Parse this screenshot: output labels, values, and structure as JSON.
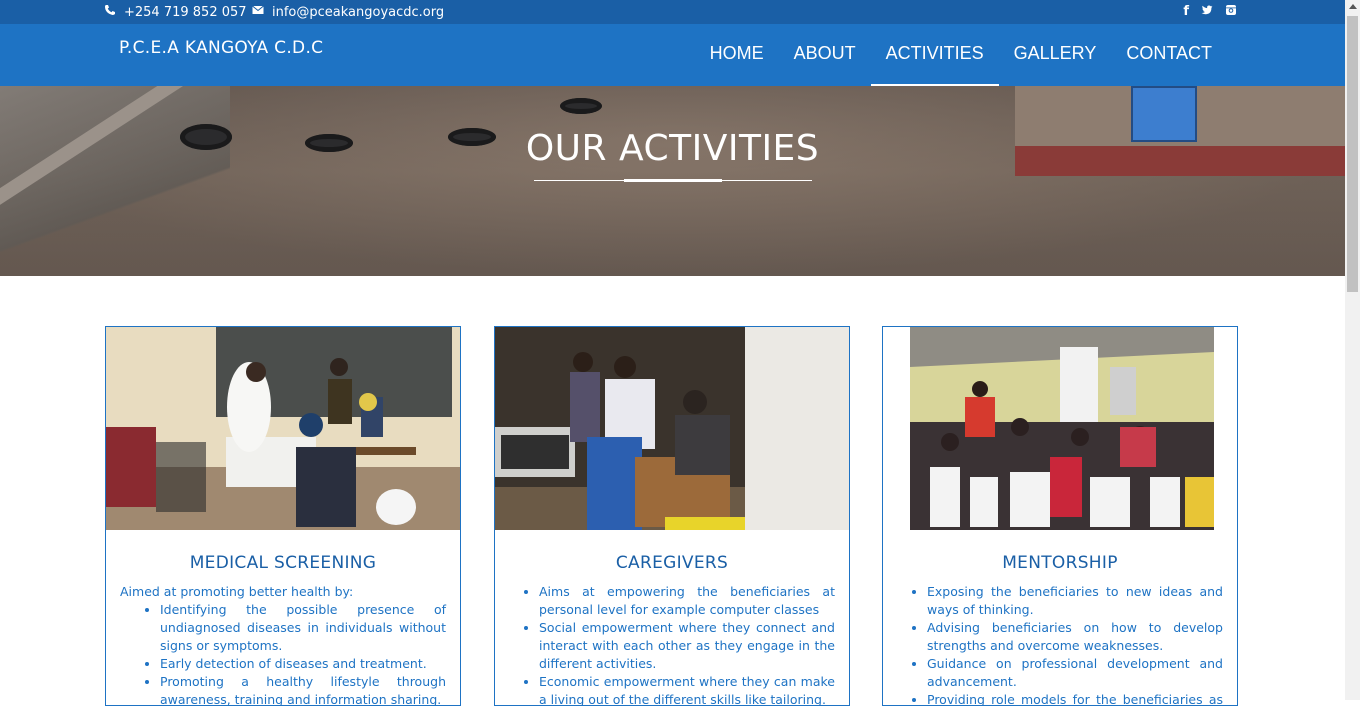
{
  "topbar": {
    "phone": "+254 719 852 057",
    "email": "info@pceakangoyacdc.org",
    "social": [
      "facebook-icon",
      "twitter-icon",
      "instagram-icon"
    ]
  },
  "nav": {
    "brand": "P.C.E.A KANGOYA C.D.C",
    "links": [
      "HOME",
      "ABOUT",
      "ACTIVITIES",
      "GALLERY",
      "CONTACT"
    ],
    "active": "ACTIVITIES"
  },
  "hero": {
    "title": "OUR ACTIVITIES"
  },
  "cards": [
    {
      "title": "MEDICAL SCREENING",
      "intro": "Aimed at promoting better health by:",
      "items": [
        "Identifying the possible presence of undiagnosed diseases in individuals without signs or symptoms.",
        "Early detection of diseases and treatment.",
        "Promoting a healthy lifestyle through awareness, training and information sharing."
      ]
    },
    {
      "title": "CAREGIVERS",
      "intro": "",
      "items": [
        "Aims at empowering the beneficiaries at personal level for example computer classes",
        "Social empowerment where they connect and interact with each other as they engage in the different activities.",
        "Economic empowerment where they can make a living out of the different skills like tailoring."
      ]
    },
    {
      "title": "MENTORSHIP",
      "intro": "",
      "items": [
        "Exposing the beneficiaries to new ideas and ways of thinking.",
        "Advising beneficiaries on how to develop strengths and overcome weaknesses.",
        "Guidance on professional development and advancement.",
        "Providing role models for the beneficiaries as they grow."
      ]
    }
  ],
  "colors": {
    "topbar": "#1a5fa6",
    "navbar": "#1e73c4",
    "accent": "#1e73c4"
  }
}
